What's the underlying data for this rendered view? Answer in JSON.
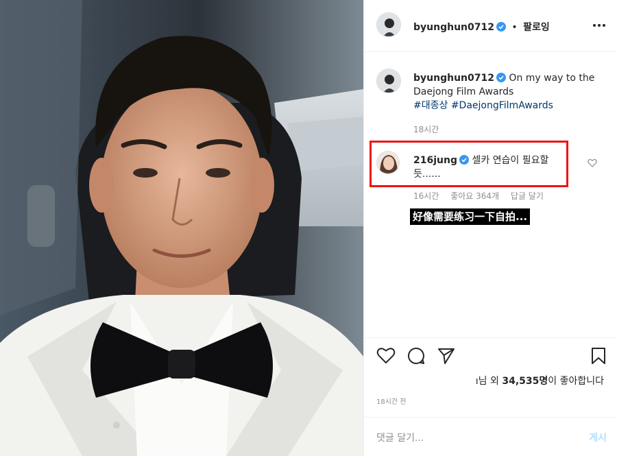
{
  "header": {
    "username": "byunghun0712",
    "separator": "•",
    "follow_label": "팔로잉",
    "more_icon": "more-options-icon"
  },
  "caption": {
    "username": "byunghun0712",
    "text": "On my way to the Daejong Film Awards",
    "hashtags": "#대종상 #DaejongFilmAwards",
    "time": "18시간"
  },
  "comment": {
    "username": "216jung",
    "text": "셀카 연습이 필요할 듯......",
    "time": "16시간",
    "likes": "좋아요 364개",
    "reply_label": "답글 달기",
    "highlight_color": "#ee1111"
  },
  "subtitle": "好像需要练习一下自拍...",
  "likes_line": {
    "prefix": "ı님 외 ",
    "count": "34,535명",
    "suffix": "이 좋아합니다"
  },
  "post_time": "18시간 전",
  "add_comment": {
    "placeholder": "댓글 달기...",
    "post_label": "게시"
  },
  "colors": {
    "verified": "#3897f0",
    "hashtag": "#00376b",
    "muted": "#8e8e8e",
    "post_button": "#b2dffc"
  }
}
